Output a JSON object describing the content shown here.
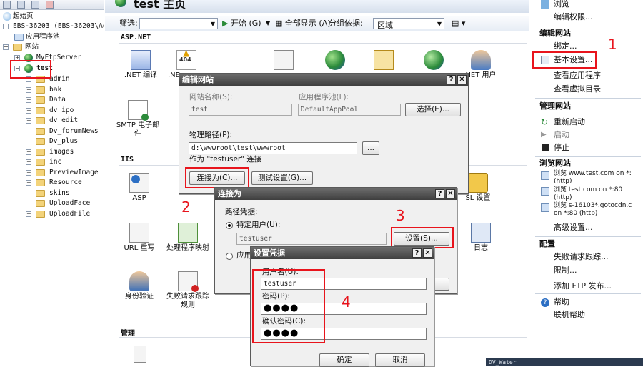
{
  "tree": {
    "items": [
      {
        "label": "起始页"
      },
      {
        "label": "EBS-36203 (EBS-36203\\Ad"
      },
      {
        "label": "应用程序池"
      },
      {
        "label": "网站"
      },
      {
        "label": "MyFtpServer"
      },
      {
        "label": "test"
      },
      {
        "label": "admin"
      },
      {
        "label": "bak"
      },
      {
        "label": "Data"
      },
      {
        "label": "dv_ipo"
      },
      {
        "label": "dv_edit"
      },
      {
        "label": "Dv_forumNews"
      },
      {
        "label": "Dv_plus"
      },
      {
        "label": "images"
      },
      {
        "label": "inc"
      },
      {
        "label": "PreviewImage"
      },
      {
        "label": "Resource"
      },
      {
        "label": "skins"
      },
      {
        "label": "UploadFace"
      },
      {
        "label": "UploadFile"
      }
    ]
  },
  "center": {
    "title": "test 主页",
    "filter": {
      "label": "筛选:",
      "start": "开始 (G)",
      "show_all": "全部显示 (A)",
      "group_by_label": "分组依据:",
      "group_by_value": "区域"
    },
    "sections": {
      "aspnet": "ASP.NET",
      "iis": "IIS",
      "manage": "管理"
    },
    "features": {
      "net_compile": ".NET 编译",
      "net_error": ".NE",
      "net_user": "NET 用户",
      "smtp": "SMTP 电子邮件",
      "asp": "ASP",
      "ssl": "SL 设置",
      "url_rewrite": "URL 重写",
      "handler": "处理程序映射",
      "logging": "日志",
      "auth": "身份验证",
      "failed_req": "失败请求跟踪规则"
    }
  },
  "right": {
    "browse": "浏览",
    "edit_perms": "编辑权限...",
    "edit_site_head": "编辑网站",
    "bindings": "绑定...",
    "basic_settings": "基本设置...",
    "view_apps": "查看应用程序",
    "view_vdirs": "查看虚拟目录",
    "manage_site_head": "管理网站",
    "restart": "重新启动",
    "start": "启动",
    "stop": "停止",
    "browse_site_head": "浏览网站",
    "browse1_a": "浏览 www.test.com on *:",
    "browse1_b": "(http)",
    "browse2_a": "浏览 test.com on *:80",
    "browse2_b": "(http)",
    "browse3_a": "浏览 s-16103*.gotocdn.c",
    "browse3_b": "on *:80 (http)",
    "advanced": "高级设置...",
    "config_head": "配置",
    "failed_req": "失败请求跟踪...",
    "limits": "限制...",
    "ftp_publish": "添加 FTP 发布...",
    "help": "帮助",
    "online_help": "联机帮助"
  },
  "edit_site_dialog": {
    "title": "编辑网站",
    "site_name_label": "网站名称(S):",
    "site_name_value": "test",
    "app_pool_label": "应用程序池(L):",
    "app_pool_value": "DefaultAppPool",
    "select_button": "选择(E)...",
    "physical_path_label": "物理路径(P):",
    "physical_path_value": "d:\\wwwroot\\test\\wwwroot",
    "browse_button": "...",
    "connect_as_note": "作为 \"testuser\" 连接",
    "connect_as_button": "连接为(C)...",
    "test_settings_button": "测试设置(G)..."
  },
  "connect_as_dialog": {
    "title": "连接为",
    "path_credentials_label": "路径凭据:",
    "specific_user_label": "特定用户(U):",
    "specific_user_value": "testuser",
    "settings_button": "设置(S)...",
    "app_user_label": "应用"
  },
  "set_credentials_dialog": {
    "title": "设置凭据",
    "username_label": "用户名(U):",
    "username_value": "testuser",
    "password_label": "密码(P):",
    "password_value": "●●●●",
    "confirm_label": "确认密码(C):",
    "confirm_value": "●●●●",
    "ok_button": "确定",
    "cancel_button": "取消"
  },
  "annotations": {
    "n1": "1",
    "n2": "2",
    "n3": "3",
    "n4": "4",
    "color": "#e8141c"
  },
  "bottom_taskbar": {
    "label": "DV_Water"
  }
}
